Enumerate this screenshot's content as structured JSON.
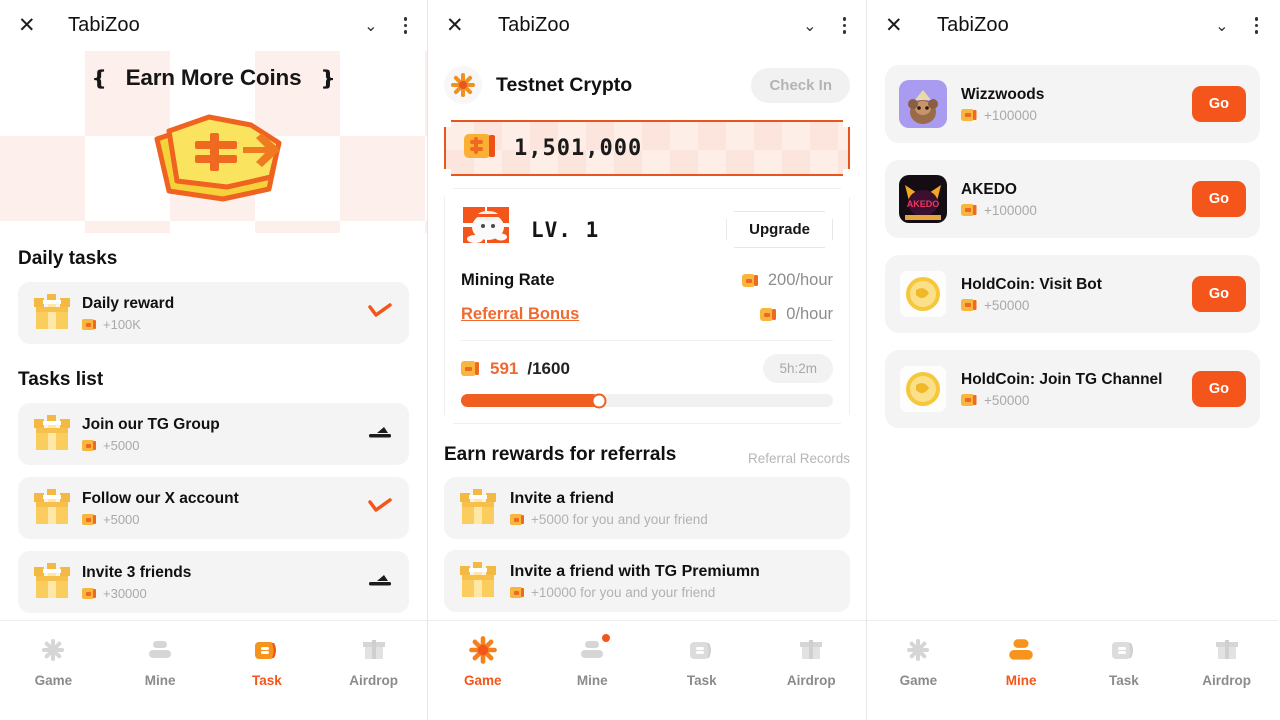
{
  "window": {
    "title": "TabiZoo",
    "close_icon": "close-icon",
    "chevron_icon": "chevron-down-icon",
    "menu_icon": "more-vertical-icon"
  },
  "panel_task": {
    "hero": {
      "title": "Earn More Coins",
      "bracket_left": "❴",
      "bracket_right": "❵",
      "art": "stacked-coins-illustration"
    },
    "daily_heading": "Daily tasks",
    "daily_tasks": [
      {
        "name": "Daily reward",
        "reward": "+100K",
        "action": "check",
        "icon": "gift-icon"
      }
    ],
    "tasks_heading": "Tasks list",
    "tasks": [
      {
        "name": "Join our TG Group",
        "reward": "+5000",
        "action": "go",
        "icon": "gift-icon"
      },
      {
        "name": "Follow our X account",
        "reward": "+5000",
        "action": "check",
        "icon": "gift-icon"
      },
      {
        "name": "Invite 3 friends",
        "reward": "+30000",
        "action": "go",
        "icon": "gift-icon"
      }
    ],
    "nav": {
      "active": "Task",
      "items": [
        {
          "label": "Game",
          "icon": "game-star-icon",
          "active": false,
          "badge": false
        },
        {
          "label": "Mine",
          "icon": "mine-stack-icon",
          "active": false,
          "badge": false
        },
        {
          "label": "Task",
          "icon": "task-coin-icon",
          "active": true,
          "badge": false
        },
        {
          "label": "Airdrop",
          "icon": "airdrop-gift-icon",
          "active": false,
          "badge": false
        }
      ]
    }
  },
  "panel_game": {
    "crypto": {
      "logo": "testnet-crypto-logo",
      "name": "Testnet Crypto",
      "checkin_label": "Check In"
    },
    "balance": {
      "value": "1,501,000",
      "coin_icon": "coin-icon"
    },
    "mining": {
      "mascot": "cat-mascot-icon",
      "level": "LV. 1",
      "upgrade_label": "Upgrade",
      "rate_label": "Mining Rate",
      "rate_value": "200/hour",
      "referral_label": "Referral Bonus",
      "referral_value": "0/hour",
      "progress_current": "591",
      "progress_total": "/1600",
      "progress_percent": 37,
      "timer": "5h:2m"
    },
    "referrals": {
      "heading": "Earn rewards for referrals",
      "records_label": "Referral Records",
      "items": [
        {
          "name": "Invite a friend",
          "sub": "+5000 for you and your friend",
          "icon": "gift-icon"
        },
        {
          "name": "Invite a friend with TG Premiumn",
          "sub": "+10000 for you and your friend",
          "icon": "gift-icon"
        }
      ]
    },
    "nav": {
      "active": "Game",
      "items": [
        {
          "label": "Game",
          "icon": "game-star-icon",
          "active": true,
          "badge": false
        },
        {
          "label": "Mine",
          "icon": "mine-stack-icon",
          "active": false,
          "badge": true
        },
        {
          "label": "Task",
          "icon": "task-coin-icon",
          "active": false,
          "badge": false
        },
        {
          "label": "Airdrop",
          "icon": "airdrop-gift-icon",
          "active": false,
          "badge": false
        }
      ]
    }
  },
  "panel_mine": {
    "drops": [
      {
        "name": "Wizzwoods",
        "reward": "+100000",
        "go_label": "Go",
        "avatar": "wizzwoods-avatar"
      },
      {
        "name": "AKEDO",
        "reward": "+100000",
        "go_label": "Go",
        "avatar": "akedo-avatar"
      },
      {
        "name": "HoldCoin: Visit Bot",
        "reward": "+50000",
        "go_label": "Go",
        "avatar": "holdcoin-avatar"
      },
      {
        "name": "HoldCoin: Join TG Channel",
        "reward": "+50000",
        "go_label": "Go",
        "avatar": "holdcoin-avatar"
      }
    ],
    "nav": {
      "active": "Mine",
      "items": [
        {
          "label": "Game",
          "icon": "game-star-icon",
          "active": false,
          "badge": false
        },
        {
          "label": "Mine",
          "icon": "mine-stack-icon",
          "active": true,
          "badge": false
        },
        {
          "label": "Task",
          "icon": "task-coin-icon",
          "active": false,
          "badge": false
        },
        {
          "label": "Airdrop",
          "icon": "airdrop-gift-icon",
          "active": false,
          "badge": false
        }
      ]
    }
  },
  "colors": {
    "accent": "#f4551b",
    "accent_soft": "#ef6a30",
    "card": "#f4f4f4",
    "muted": "#a9a9a9"
  }
}
